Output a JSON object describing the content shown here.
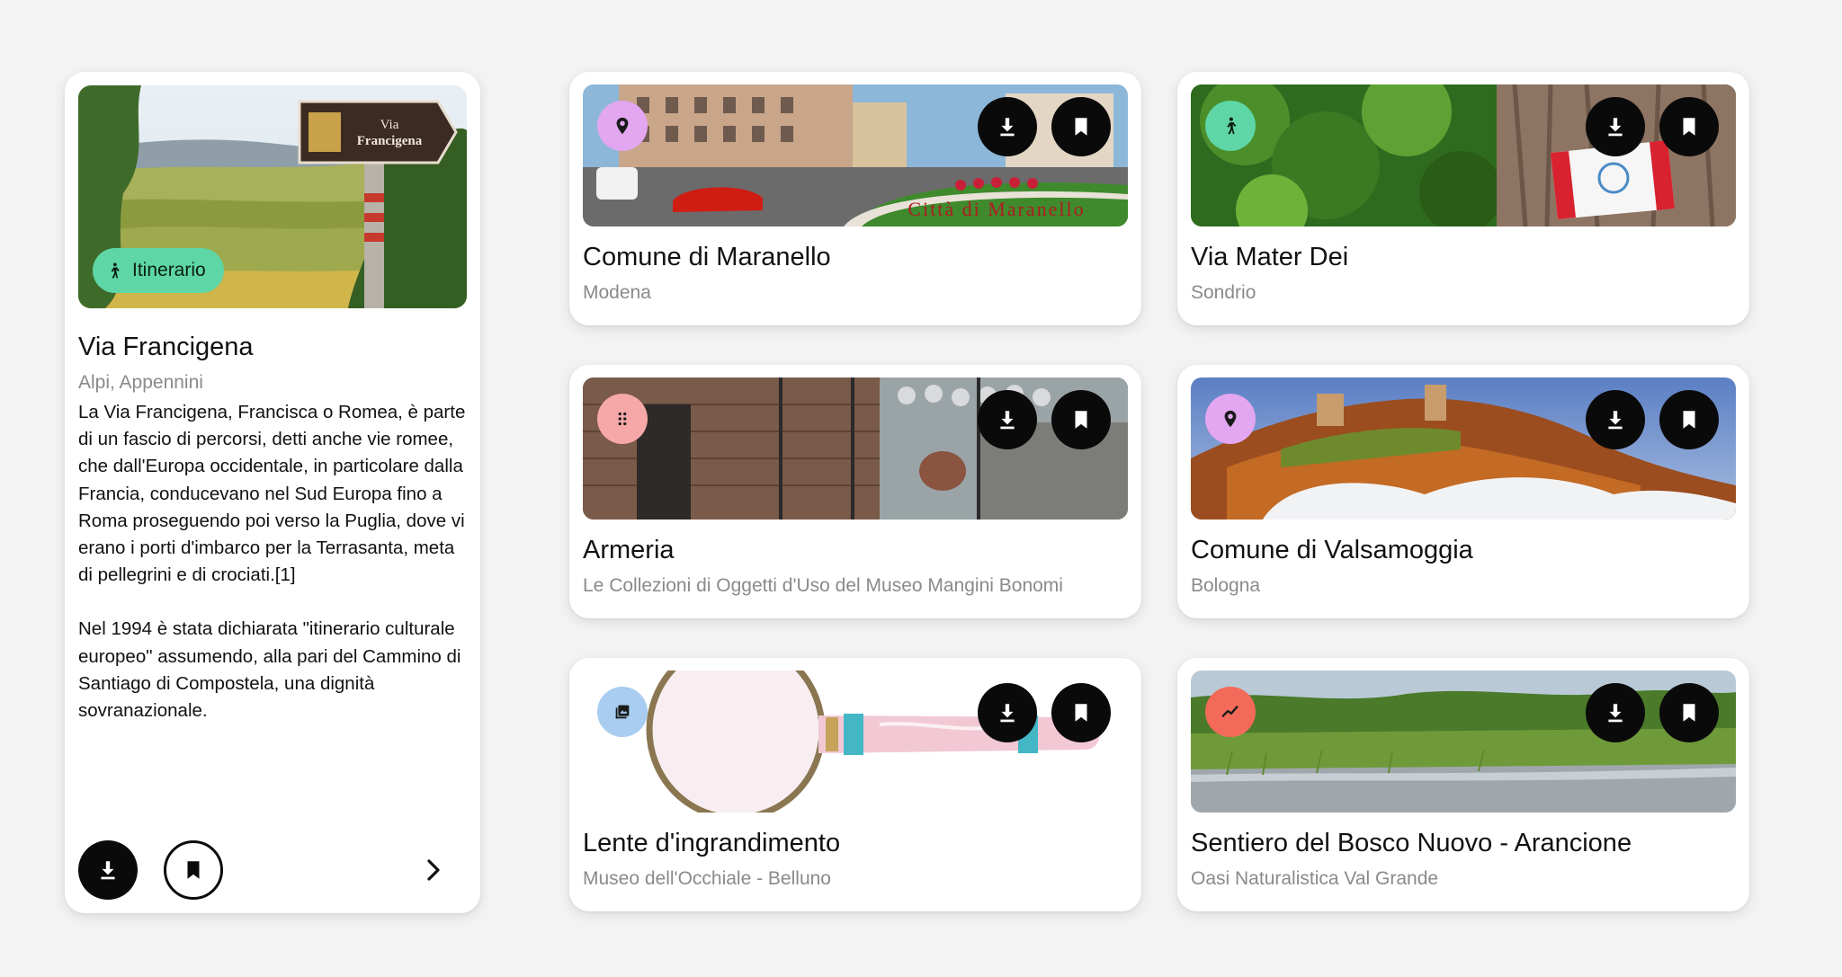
{
  "featured": {
    "tag_label": "Itinerario",
    "sign_text_line1": "Via",
    "sign_text_line2": "Francigena",
    "title": "Via Francigena",
    "subtitle": "Alpi, Appennini",
    "description_p1": "La Via Francigena, Francisca o Romea, è parte di un fascio di percorsi, detti anche vie romee, che dall'Europa occidentale, in particolare dalla Francia, conducevano nel Sud Europa fino a Roma proseguendo poi verso la Puglia, dove vi erano i porti d'imbarco per la Terrasanta, meta di pellegrini e di crociati.[1]",
    "description_p2": "Nel 1994 è stata dichiarata \"itinerario culturale europeo\" assumendo, alla pari del Cammino di Santiago di Compostela, una dignità sovranazionale.",
    "tag_color": "#5ed6a6"
  },
  "cards": [
    {
      "id": "maranello",
      "title": "Comune di Maranello",
      "subtitle": "Modena",
      "badge_icon": "map-pin-icon",
      "badge_color": "#e3a6f0",
      "image_text": "Città di Maranello"
    },
    {
      "id": "matedei",
      "title": "Via Mater Dei",
      "subtitle": "Sondrio",
      "badge_icon": "hiker-icon",
      "badge_color": "#5ed6a6"
    },
    {
      "id": "armeria",
      "title": "Armeria",
      "subtitle": "Le Collezioni di Oggetti d'Uso del Museo Mangini Bonomi",
      "badge_icon": "grid-dots-icon",
      "badge_color": "#f6a8a8"
    },
    {
      "id": "valsamoggia",
      "title": "Comune di Valsamoggia",
      "subtitle": "Bologna",
      "badge_icon": "map-pin-icon",
      "badge_color": "#e3a6f0"
    },
    {
      "id": "lente",
      "title": "Lente d'ingrandimento",
      "subtitle": "Museo dell'Occhiale - Belluno",
      "badge_icon": "image-icon",
      "badge_color": "#a8cdf0"
    },
    {
      "id": "sentiero",
      "title": "Sentiero del Bosco Nuovo - Arancione",
      "subtitle": "Oasi Naturalistica Val Grande",
      "badge_icon": "trend-icon",
      "badge_color": "#f46a5a"
    }
  ]
}
